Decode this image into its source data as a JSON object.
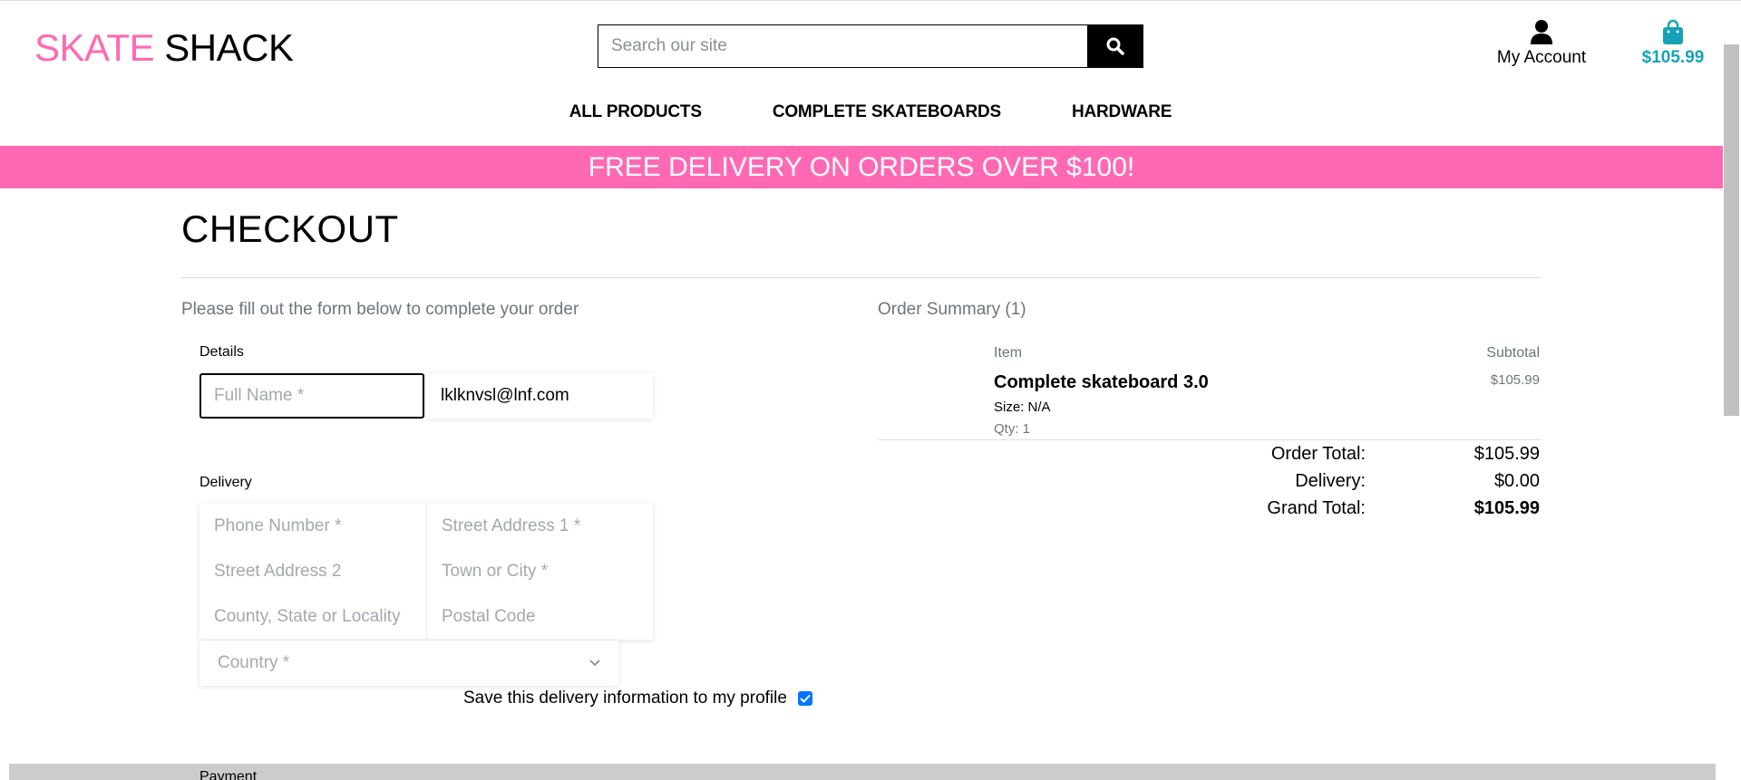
{
  "header": {
    "logo_part1": "SKATE",
    "logo_part2": "SHACK",
    "search_placeholder": "Search our site",
    "account_label": "My Account",
    "bag_total": "$105.99",
    "search_icon": "search-icon",
    "account_icon": "user-icon",
    "bag_icon": "shopping-bag-icon"
  },
  "nav": {
    "items": [
      "ALL PRODUCTS",
      "COMPLETE SKATEBOARDS",
      "HARDWARE"
    ]
  },
  "banner": "FREE DELIVERY ON ORDERS OVER $100!",
  "checkout": {
    "title": "CHECKOUT",
    "intro": "Please fill out the form below to complete your order",
    "details_legend": "Details",
    "full_name_placeholder": "Full Name *",
    "email_value": "lklknvsl@lnf.com",
    "delivery_legend": "Delivery",
    "phone_placeholder": "Phone Number *",
    "street1_placeholder": "Street Address 1 *",
    "street2_placeholder": "Street Address 2",
    "town_placeholder": "Town or City *",
    "county_placeholder": "County, State or Locality",
    "postcode_placeholder": "Postal Code",
    "country_placeholder": "Country *",
    "save_label": "Save this delivery information to my profile",
    "save_checked": true,
    "payment_legend": "Payment"
  },
  "order_summary": {
    "title": "Order Summary (1)",
    "col_item": "Item",
    "col_subtotal": "Subtotal",
    "item_name": "Complete skateboard 3.0",
    "item_size": "Size: N/A",
    "item_qty": "Qty: 1",
    "item_subtotal": "$105.99",
    "order_total_label": "Order Total:",
    "order_total": "$105.99",
    "delivery_label": "Delivery:",
    "delivery": "$0.00",
    "grand_total_label": "Grand Total:",
    "grand_total": "$105.99"
  },
  "colors": {
    "brand_pink": "#ff69b4",
    "accent_teal": "#17a2b8"
  }
}
